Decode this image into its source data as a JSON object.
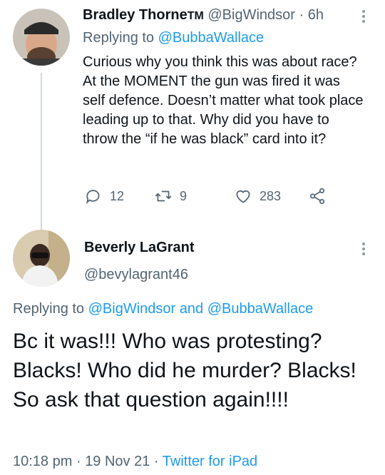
{
  "tweet1": {
    "author_name": "Bradley Thorne",
    "author_badge": "TM",
    "handle": "@BigWindsor",
    "separator": "·",
    "time": "6h",
    "replying_prefix": "Replying to",
    "replying_to": "@BubbaWallace",
    "body": "Curious why you think this was about race? At the MOMENT the gun was fired it was self defence. Doesn’t matter what took place leading up to that. Why did you have to throw the “if he was black” card into it?",
    "reply_count": "12",
    "retweet_count": "9",
    "like_count": "283"
  },
  "tweet2": {
    "author_name": "Beverly LaGrant",
    "handle": "@bevylagrant46",
    "replying_prefix": "Replying to",
    "replying_to_1": "@BigWindsor",
    "replying_and": "and",
    "replying_to_2": "@BubbaWallace",
    "body": "Bc it was!!! Who was protesting? Blacks! Who did he murder? Blacks! So ask that question again!!!!",
    "time": "10:18 pm",
    "separator": "·",
    "date": "19 Nov 21",
    "source": "Twitter for iPad"
  },
  "colors": {
    "link": "#1d9bf0",
    "muted": "#536471",
    "text": "#0f1419"
  }
}
